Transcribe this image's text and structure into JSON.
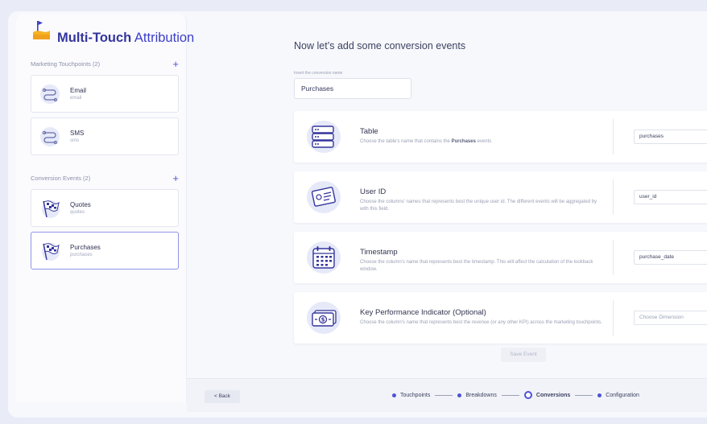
{
  "brand": {
    "bold": "Multi-Touch",
    "rest": " Attribution"
  },
  "sidebar": {
    "touchpoints_header": "Marketing Touchpoints (2)",
    "touchpoints": [
      {
        "title": "Email",
        "sub": "email"
      },
      {
        "title": "SMS",
        "sub": "sms"
      }
    ],
    "conversions_header": "Conversion Events (2)",
    "conversions": [
      {
        "title": "Quotes",
        "sub": "quotes"
      },
      {
        "title": "Purchases",
        "sub": "purchases"
      }
    ],
    "add_symbol": "+"
  },
  "main": {
    "title": "Now let’s add some conversion events",
    "name_label": "Insert the conversion name",
    "name_value": "Purchases",
    "cards": [
      {
        "title": "Table",
        "desc_pre": "Choose the table's name that contains the ",
        "desc_bold": "Purchases",
        "desc_post": " events",
        "value": "purchases"
      },
      {
        "title": "User ID",
        "desc_pre": "Choose the columns' names that represents best the unique user id. The different events will be aggregated by with this field.",
        "desc_bold": "",
        "desc_post": "",
        "value": "user_id"
      },
      {
        "title": "Timestamp",
        "desc_pre": "Choose the column's name that represents best the timestamp. This will affect the calculation of the lookback window.",
        "desc_bold": "",
        "desc_post": "",
        "value": "purchase_date"
      },
      {
        "title": "Key Performance Indicator (Optional)",
        "desc_pre": "Choose the column's name that represents best the revenue (or any other KPI) across the marketing touchpoints.",
        "desc_bold": "",
        "desc_post": "",
        "placeholder": "Choose Dimension"
      }
    ],
    "save_label": "Save Event"
  },
  "footer": {
    "back_label": "< Back",
    "steps": [
      "Touchpoints",
      "Breakdowns",
      "Conversions",
      "Configuration"
    ],
    "current_step": "Conversions"
  },
  "colors": {
    "accent": "#4e52d6",
    "brand": "#3b3ec8",
    "icon_bg": "#e6e9f8"
  },
  "icons": {
    "brand": "flag-icon",
    "touchpoint": "route-icon",
    "conversion": "checkered-flag-icon",
    "cards": [
      "database-icon",
      "id-card-icon",
      "calendar-icon",
      "money-icon"
    ]
  }
}
